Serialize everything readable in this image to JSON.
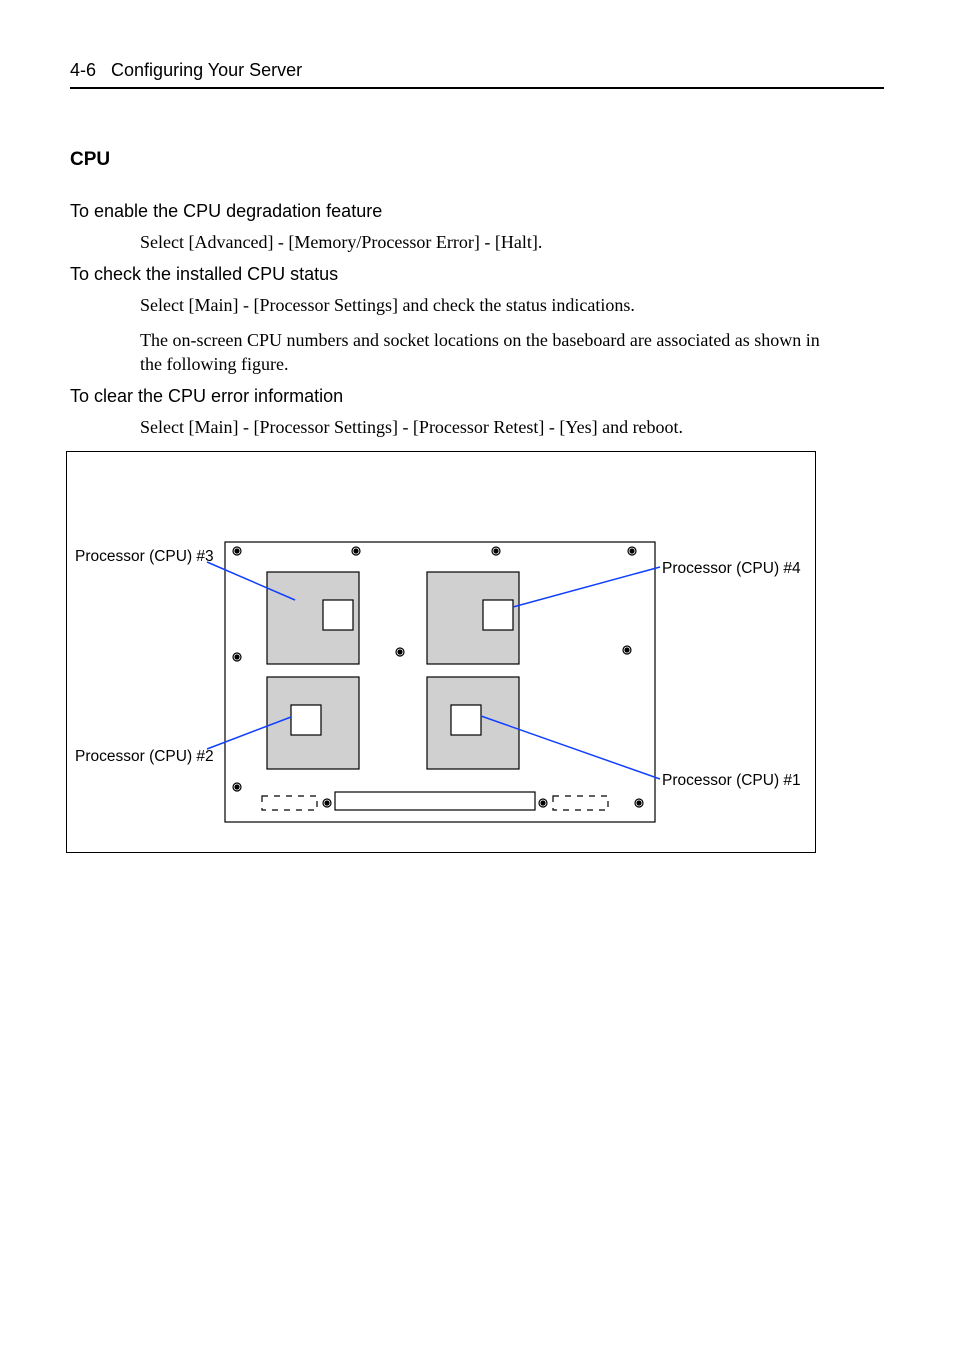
{
  "header": {
    "page_number": "4-6",
    "chapter_title": "Configuring Your Server"
  },
  "section": {
    "title": "CPU",
    "blocks": [
      {
        "heading": "To enable the CPU degradation feature",
        "paras": [
          "Select [Advanced] - [Memory/Processor Error] - [Halt]."
        ]
      },
      {
        "heading": "To check the installed CPU status",
        "paras": [
          "Select [Main] - [Processor Settings] and check the status indications.",
          "The on-screen CPU numbers and socket locations on the baseboard are associated as shown in the following figure."
        ]
      },
      {
        "heading": "To clear the CPU error information",
        "paras": [
          "Select [Main] - [Processor Settings] - [Processor Retest] - [Yes] and reboot."
        ]
      }
    ]
  },
  "figure": {
    "labels": {
      "cpu3": "Processor (CPU) #3",
      "cpu4": "Processor (CPU) #4",
      "cpu2": "Processor (CPU) #2",
      "cpu1": "Processor (CPU) #1"
    }
  }
}
